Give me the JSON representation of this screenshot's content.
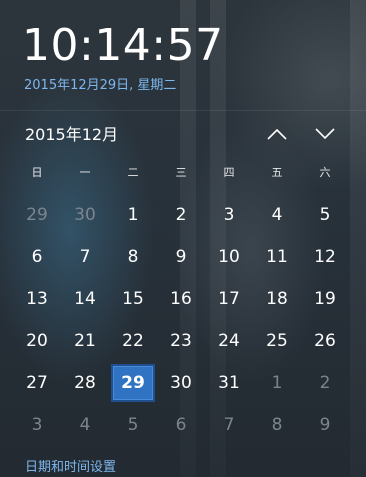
{
  "clock": {
    "time": "10:14:57",
    "date_full": "2015年12月29日, 星期二"
  },
  "calendar": {
    "month_title": "2015年12月",
    "weekdays": [
      "日",
      "一",
      "二",
      "三",
      "四",
      "五",
      "六"
    ],
    "weeks": [
      [
        {
          "d": "29",
          "cur": false
        },
        {
          "d": "30",
          "cur": false
        },
        {
          "d": "1",
          "cur": true
        },
        {
          "d": "2",
          "cur": true
        },
        {
          "d": "3",
          "cur": true
        },
        {
          "d": "4",
          "cur": true
        },
        {
          "d": "5",
          "cur": true
        }
      ],
      [
        {
          "d": "6",
          "cur": true
        },
        {
          "d": "7",
          "cur": true
        },
        {
          "d": "8",
          "cur": true
        },
        {
          "d": "9",
          "cur": true
        },
        {
          "d": "10",
          "cur": true
        },
        {
          "d": "11",
          "cur": true
        },
        {
          "d": "12",
          "cur": true
        }
      ],
      [
        {
          "d": "13",
          "cur": true
        },
        {
          "d": "14",
          "cur": true
        },
        {
          "d": "15",
          "cur": true
        },
        {
          "d": "16",
          "cur": true
        },
        {
          "d": "17",
          "cur": true
        },
        {
          "d": "18",
          "cur": true
        },
        {
          "d": "19",
          "cur": true
        }
      ],
      [
        {
          "d": "20",
          "cur": true
        },
        {
          "d": "21",
          "cur": true
        },
        {
          "d": "22",
          "cur": true
        },
        {
          "d": "23",
          "cur": true
        },
        {
          "d": "24",
          "cur": true
        },
        {
          "d": "25",
          "cur": true
        },
        {
          "d": "26",
          "cur": true
        }
      ],
      [
        {
          "d": "27",
          "cur": true
        },
        {
          "d": "28",
          "cur": true
        },
        {
          "d": "29",
          "cur": true,
          "today": true
        },
        {
          "d": "30",
          "cur": true
        },
        {
          "d": "31",
          "cur": true
        },
        {
          "d": "1",
          "cur": false
        },
        {
          "d": "2",
          "cur": false
        }
      ],
      [
        {
          "d": "3",
          "cur": false
        },
        {
          "d": "4",
          "cur": false
        },
        {
          "d": "5",
          "cur": false
        },
        {
          "d": "6",
          "cur": false
        },
        {
          "d": "7",
          "cur": false
        },
        {
          "d": "8",
          "cur": false
        },
        {
          "d": "9",
          "cur": false
        }
      ]
    ],
    "nav": {
      "prev_icon": "chevron-up-icon",
      "next_icon": "chevron-down-icon"
    }
  },
  "footer": {
    "settings_link": "日期和时间设置"
  },
  "colors": {
    "accent": "#2f73c2",
    "link": "#7cb7ee",
    "muted_day": "#7c858d"
  }
}
